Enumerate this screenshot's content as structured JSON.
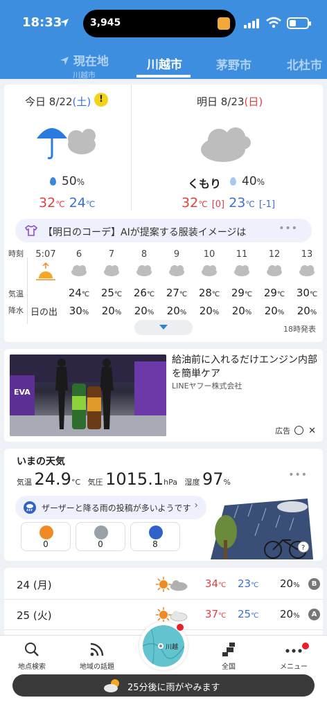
{
  "status": {
    "time": "18:33",
    "island_count": "3,945"
  },
  "tabs": [
    {
      "label": "現在地",
      "sub": "川越市"
    },
    {
      "label": "川越市"
    },
    {
      "label": "茅野市"
    },
    {
      "label": "北杜市"
    }
  ],
  "today": {
    "label": "今日",
    "date": "8/22",
    "dow": "(土)",
    "pop": "50",
    "pop_unit": "%",
    "hi": "32",
    "lo": "24",
    "deg": "℃"
  },
  "tomorrow": {
    "label": "明日",
    "date": "8/23",
    "dow": "(日)",
    "weather": "くもり",
    "pop": "40",
    "pop_unit": "%",
    "hi": "32",
    "hi_diff": "[0]",
    "lo": "23",
    "lo_diff": "[-1]",
    "deg": "℃"
  },
  "coordinate": {
    "text": "【明日のコーデ】AIが提案する服装イメージは"
  },
  "hourly": {
    "row_labels": {
      "time": "時刻",
      "temp": "気温",
      "pop": "降水"
    },
    "sunset_time": "5:07",
    "sunset_label": "日の出",
    "hours": [
      {
        "h": "6",
        "t": "24",
        "p": "30"
      },
      {
        "h": "7",
        "t": "25",
        "p": "20"
      },
      {
        "h": "8",
        "t": "26",
        "p": "20"
      },
      {
        "h": "9",
        "t": "27",
        "p": "20"
      },
      {
        "h": "10",
        "t": "28",
        "p": "20"
      },
      {
        "h": "11",
        "t": "29",
        "p": "20"
      },
      {
        "h": "12",
        "t": "29",
        "p": "20"
      },
      {
        "h": "13",
        "t": "30",
        "p": "20"
      }
    ],
    "deg": "℃",
    "pct": "%",
    "issued": "18時発表"
  },
  "ad": {
    "title": "給油前に入れるだけエンジン内部を簡単ケア",
    "company": "LINEヤフー株式会社",
    "label": "広告"
  },
  "now": {
    "title": "いまの天気",
    "temp_label": "気温",
    "temp": "24.9",
    "temp_unit": "°C",
    "pressure_label": "気圧",
    "pressure": "1015.1",
    "pressure_unit": "hPa",
    "humidity_label": "湿度",
    "humidity": "97",
    "humidity_unit": "%",
    "bubble": "ザーザーと降る雨の投稿が多いようです",
    "reports": [
      "0",
      "0",
      "8"
    ]
  },
  "daily": [
    {
      "date": "24",
      "dow": "(月)",
      "hi": "34",
      "lo": "23",
      "pop": "20",
      "badge": "B"
    },
    {
      "date": "25",
      "dow": "(火)",
      "hi": "37",
      "lo": "25",
      "pop": "20",
      "badge": "A"
    }
  ],
  "nav": {
    "search": "地点検索",
    "topics": "地域の話題",
    "radar_label": "川越",
    "national": "全国",
    "menu": "メニュー"
  },
  "toast": {
    "text": "25分後に雨がやみます"
  },
  "colors": {
    "header": "#3e8ee0",
    "hi": "#e04040",
    "lo": "#3a6fd8",
    "alert": "#e8202a"
  }
}
